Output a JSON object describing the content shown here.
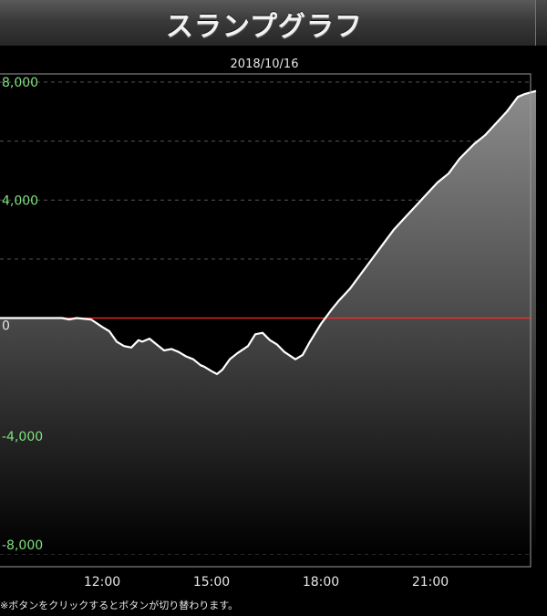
{
  "header": {
    "title": "スランプグラフ"
  },
  "footnote": "※ボタンをクリックするとボタンが切り替わります。",
  "chart_data": {
    "type": "area",
    "title": "2018/10/16",
    "xlabel": "",
    "ylabel": "",
    "x_unit": "hour",
    "xlim": [
      9.2,
      24.2
    ],
    "ylim": [
      -8000,
      8000
    ],
    "y_ticks": [
      8000,
      4000,
      0,
      -4000,
      -8000
    ],
    "y_tick_labels": [
      "8,000",
      "4,000",
      "0",
      "-4,000",
      "-8,000"
    ],
    "x_ticks": [
      12,
      15,
      18,
      21
    ],
    "x_tick_labels": [
      "12:00",
      "15:00",
      "18:00",
      "21:00"
    ],
    "grid": true,
    "zero_line_color": "#ff2a2a",
    "tick_label_color": "#7ee07e",
    "line_color": "#ffffff",
    "series": [
      {
        "x": [
          9.2,
          10.9,
          11.1,
          11.3,
          11.7,
          12.0,
          12.2,
          12.4,
          12.6,
          12.8,
          13.0,
          13.1,
          13.3,
          13.5,
          13.7,
          13.9,
          14.1,
          14.3,
          14.5,
          14.7,
          14.8,
          15.0,
          15.15,
          15.3,
          15.5,
          15.7,
          16.0,
          16.2,
          16.4,
          16.6,
          16.8,
          17.0,
          17.3,
          17.5,
          17.7,
          18.0,
          18.3,
          18.5,
          18.8,
          19.1,
          19.4,
          19.7,
          20.0,
          20.3,
          20.6,
          20.9,
          21.2,
          21.5,
          21.8,
          22.2,
          22.5,
          22.8,
          23.1,
          23.4,
          23.6,
          23.9
        ],
        "values": [
          0,
          0,
          -50,
          0,
          -50,
          -300,
          -450,
          -800,
          -950,
          -1000,
          -750,
          -800,
          -700,
          -900,
          -1100,
          -1050,
          -1150,
          -1300,
          -1400,
          -1600,
          -1650,
          -1800,
          -1900,
          -1750,
          -1400,
          -1200,
          -950,
          -550,
          -500,
          -750,
          -900,
          -1150,
          -1400,
          -1250,
          -800,
          -200,
          300,
          600,
          1000,
          1500,
          2000,
          2500,
          3000,
          3400,
          3800,
          4200,
          4600,
          4900,
          5400,
          5900,
          6200,
          6600,
          7000,
          7500,
          7600,
          7700
        ]
      }
    ]
  }
}
